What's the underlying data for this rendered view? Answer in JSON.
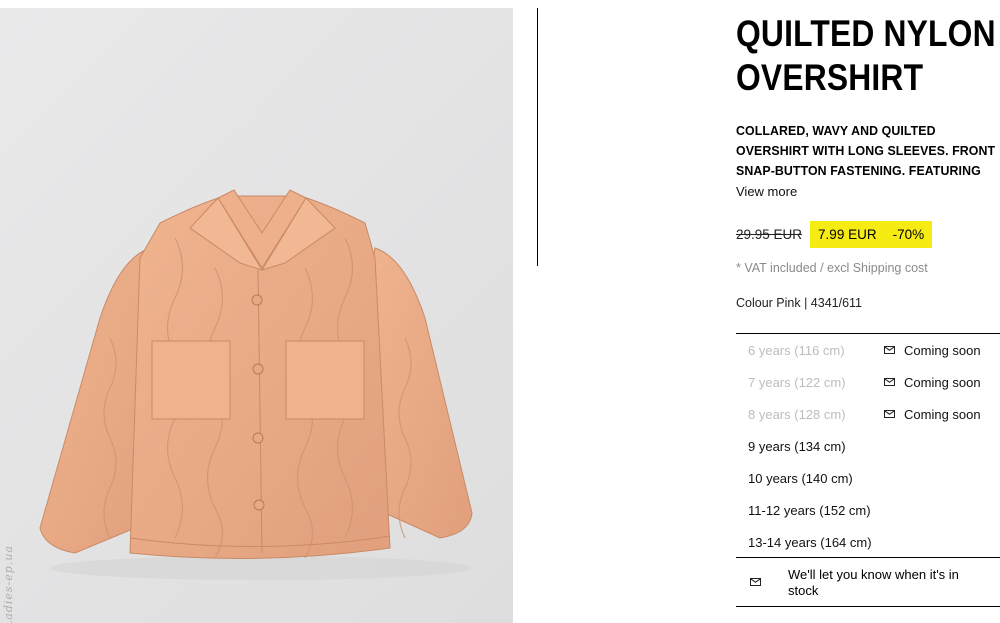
{
  "product": {
    "title_line1": "QUILTED NYLON",
    "title_line2": "OVERSHIRT",
    "description": "COLLARED, WAVY AND QUILTED OVERSHIRT WITH LONG SLEEVES. FRONT SNAP-BUTTON FASTENING. FEATURING",
    "view_more": "View more",
    "old_price": "29.95 EUR",
    "new_price": "7.99 EUR",
    "discount": "-70%",
    "vat_note": "* VAT included / excl Shipping cost",
    "colour": "Colour Pink | 4341/611",
    "image_icon": "quilted-overshirt-photo",
    "watermark": "Ladies-ep.ua"
  },
  "sizes": [
    {
      "label": "6 years (116 cm)",
      "available": false,
      "notify": "Coming soon"
    },
    {
      "label": "7 years (122 cm)",
      "available": false,
      "notify": "Coming soon"
    },
    {
      "label": "8 years (128 cm)",
      "available": false,
      "notify": "Coming soon"
    },
    {
      "label": "9 years (134 cm)",
      "available": true,
      "notify": ""
    },
    {
      "label": "10 years (140 cm)",
      "available": true,
      "notify": ""
    },
    {
      "label": "11-12 years (152 cm)",
      "available": true,
      "notify": ""
    },
    {
      "label": "13-14 years (164 cm)",
      "available": true,
      "notify": ""
    }
  ],
  "stock_notice": "We'll let you know when it's in stock",
  "colors": {
    "sale_highlight": "#f6eb13",
    "unavailable_text": "#bdbdbd",
    "jacket": "#e8ab88"
  }
}
